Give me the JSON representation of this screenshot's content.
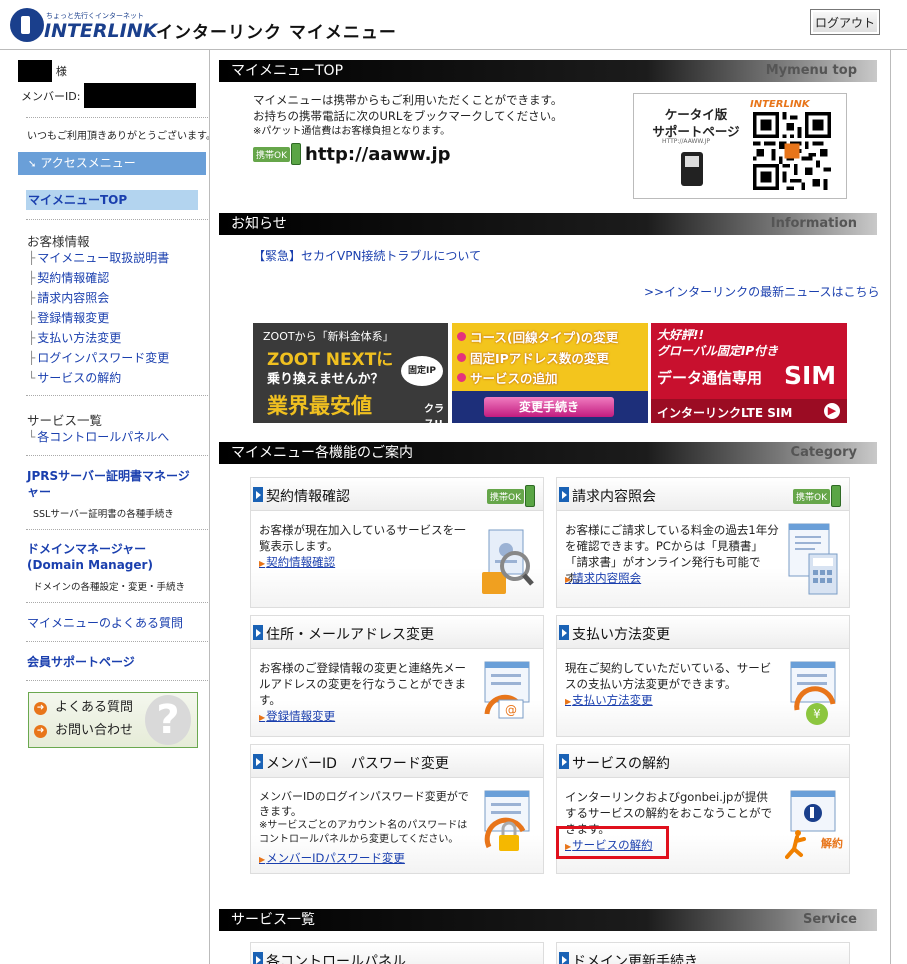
{
  "header": {
    "logo_tagline": "ちょっと先行くインターネット",
    "logo_word": "INTERLINK",
    "title": "インターリンク マイメニュー",
    "logout_label": "ログアウト"
  },
  "sidebar": {
    "name_suffix": "様",
    "member_id_label": "メンバーID:",
    "greeting": "いつもご利用頂きありがとうございます。",
    "access_menu": "アクセスメニュー",
    "mymenu_top": "マイメニューTOP",
    "customer_info_heading": "お客様情報",
    "customer_items": [
      {
        "label": "マイメニュー取扱説明書"
      },
      {
        "label": "契約情報確認"
      },
      {
        "label": "請求内容照会"
      },
      {
        "label": "登録情報変更"
      },
      {
        "label": "支払い方法変更"
      },
      {
        "label": "ログインパスワード変更"
      },
      {
        "label": "サービスの解約"
      }
    ],
    "services_heading": "サービス一覧",
    "services_items": [
      {
        "label": "各コントロールパネルへ"
      }
    ],
    "jprs_link": "JPRSサーバー証明書マネージャー",
    "jprs_desc": "SSLサーバー証明書の各種手続き",
    "domain_link": "ドメインマネージャー\n(Domain Manager)",
    "domain_desc": "ドメインの各種設定・変更・手続き",
    "faq_link": "マイメニューのよくある質問",
    "support_link": "会員サポートページ",
    "faq_box": {
      "faq": "よくある質問",
      "contact": "お問い合わせ"
    }
  },
  "sections": {
    "top": {
      "title": "マイメニューTOP",
      "en": "Mymenu top"
    },
    "news": {
      "title": "お知らせ",
      "en": "Information"
    },
    "category": {
      "title": "マイメニュー各機能のご案内",
      "en": "Category"
    },
    "service": {
      "title": "サービス一覧",
      "en": "Service"
    }
  },
  "intro": {
    "line1": "マイメニューは携帯からもご利用いただくことができます。",
    "line2": "お持ちの携帯電話に次のURLをブックマークしてください。",
    "note": "※パケット通信費はお客様負担となります。",
    "mobile_badge": "携帯OK",
    "mobile_url": "http://aaww.jp",
    "qr_title": "ケータイ版\nサポートページ",
    "qr_url": "HTTP://AAWW.JP",
    "qr_brand": "INTERLINK"
  },
  "news": {
    "item": "【緊急】セカイVPN接続トラブルについて",
    "more": ">>インターリンクの最新ニュースはこちら"
  },
  "banners": {
    "zoot": {
      "line1": "ZOOTから「新料金体系」",
      "line2": "ZOOT NEXTに",
      "line3": "乗り換えませんか？",
      "badge": "固定IP",
      "line4": "業界最安値",
      "line5": "クラス!!"
    },
    "change": {
      "item1": "コース(回線タイプ)の変更",
      "item2": "固定IPアドレス数の変更",
      "item3": "サービスの追加",
      "button": "変更手続き"
    },
    "sim": {
      "line1": "大好評!!",
      "line2": "グローバル固定IP付き",
      "line3": "データ通信専用",
      "sim": "SIM",
      "line4": "インターリンクLTE SIM"
    }
  },
  "cards": [
    {
      "title": "契約情報確認",
      "badge": "携帯OK",
      "desc": "お客様が現在加入しているサービスを一覧表示します。",
      "link": "契約情報確認"
    },
    {
      "title": "請求内容照会",
      "badge": "携帯OK",
      "desc": "お客様にご請求している料金の過去1年分を確認できます。PCからは「見積書」「請求書」がオンライン発行も可能です。",
      "link": "請求内容照会"
    },
    {
      "title": "住所・メールアドレス変更",
      "desc": "お客様のご登録情報の変更と連絡先メールアドレスの変更を行なうことができます。",
      "link": "登録情報変更"
    },
    {
      "title": "支払い方法変更",
      "desc": "現在ご契約していただいている、サービスの支払い方法変更ができます。",
      "link": "支払い方法変更"
    },
    {
      "title": "メンバーID　パスワード変更",
      "desc": "メンバーIDのログインパスワード変更ができます。",
      "note": "※サービスごとのアカウント名のパスワードはコントロールパネルから変更してください。",
      "link": "メンバーIDパスワード変更"
    },
    {
      "title": "サービスの解約",
      "desc": "インターリンクおよびgonbei.jpが提供するサービスの解約をおこなうことができます。",
      "link": "サービスの解約",
      "ill_label": "解約"
    }
  ],
  "bottom_cards": [
    {
      "title": "各コントロールパネル"
    },
    {
      "title": "ドメイン更新手続き"
    }
  ]
}
